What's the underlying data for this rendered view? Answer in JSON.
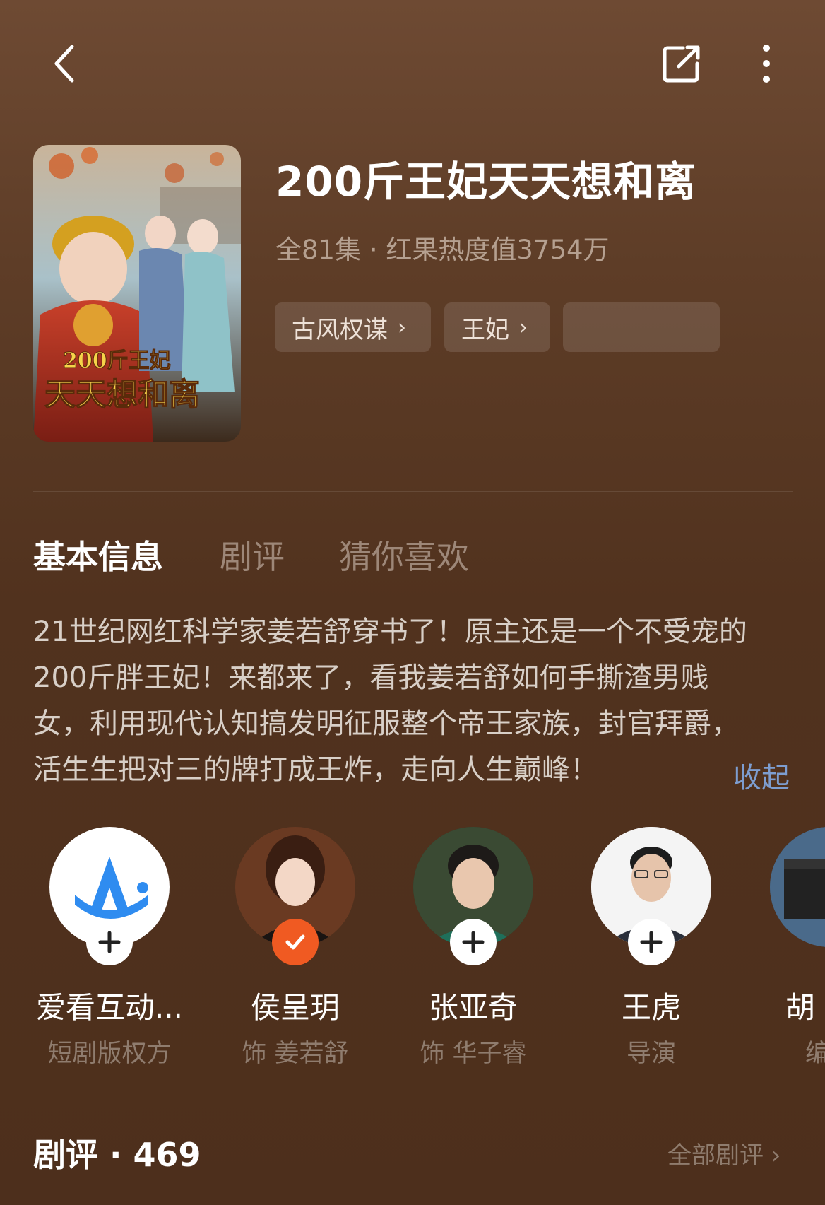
{
  "header": {
    "back_icon": "chevron-left-icon",
    "share_icon": "share-icon",
    "more_icon": "more-vertical-icon"
  },
  "drama": {
    "poster_text_line1": "200斤王妃",
    "poster_text_line2": "天天想和离",
    "title": "200斤王妃天天想和离",
    "meta": "全81集 · 红果热度值3754万",
    "tags": [
      {
        "label": "古风权谋"
      },
      {
        "label": "王妃"
      }
    ]
  },
  "tabs": {
    "basic": "基本信息",
    "review": "剧评",
    "guess": "猜你喜欢"
  },
  "description": {
    "line1": "21世纪网红科学家姜若舒穿书了！原主还是一个不受宠的",
    "line2": "200斤胖王妃！来都来了，看我姜若舒如何手撕渣男贱",
    "line3": "女，利用现代认知搞发明征服整个帝王家族，封官拜爵，",
    "line4": "活生生把对三的牌打成王炸，走向人生巅峰！",
    "collapse_label": "收起"
  },
  "cast": [
    {
      "name": "爱看互动...",
      "role": "短剧版权方",
      "followed": false
    },
    {
      "name": "侯呈玥",
      "role": "饰 姜若舒",
      "followed": true
    },
    {
      "name": "张亚奇",
      "role": "饰 华子睿",
      "followed": false
    },
    {
      "name": "王虎",
      "role": "导演",
      "followed": false
    },
    {
      "name": "胡",
      "role": "编",
      "followed": false
    }
  ],
  "reviews": {
    "heading": "剧评 · 469",
    "all_label": "全部剧评"
  },
  "colors": {
    "accent_check": "#f05a22",
    "link_blue": "#7d9dd0"
  }
}
